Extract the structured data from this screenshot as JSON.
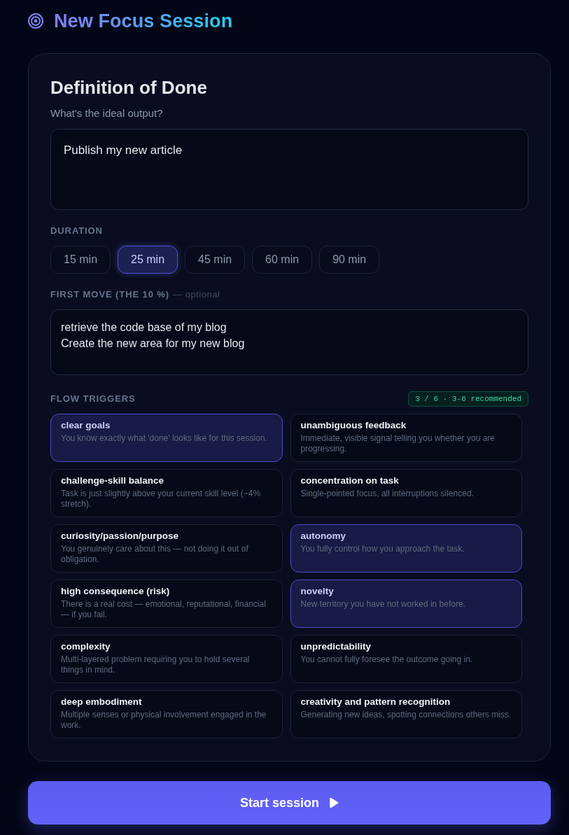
{
  "header": {
    "title": "New Focus Session"
  },
  "card": {
    "title": "Definition of Done",
    "output": {
      "label": "What's the ideal output?",
      "value": "Publish my new article"
    },
    "duration": {
      "label": "DURATION",
      "options": [
        {
          "label": "15 min",
          "selected": false
        },
        {
          "label": "25 min",
          "selected": true
        },
        {
          "label": "45 min",
          "selected": false
        },
        {
          "label": "60 min",
          "selected": false
        },
        {
          "label": "90 min",
          "selected": false
        }
      ]
    },
    "first_move": {
      "label": "FIRST MOVE (THE 10 %)",
      "hint": "— optional",
      "value": "retrieve the code base of my blog\nCreate the new area for my new blog"
    },
    "flow_triggers": {
      "label": "FLOW TRIGGERS",
      "badge": "3 / 6 · 3-6 recommended",
      "items": [
        {
          "title": "clear goals",
          "description": "You know exactly what 'done' looks like for this session.",
          "selected": true
        },
        {
          "title": "unambiguous feedback",
          "description": "Immediate, visible signal telling you whether you are progressing.",
          "selected": false
        },
        {
          "title": "challenge-skill balance",
          "description": "Task is just slightly above your current skill level (~4% stretch).",
          "selected": false
        },
        {
          "title": "concentration on task",
          "description": "Single-pointed focus, all interruptions silenced.",
          "selected": false
        },
        {
          "title": "curiosity/passion/purpose",
          "description": "You genuinely care about this — not doing it out of obligation.",
          "selected": false
        },
        {
          "title": "autonomy",
          "description": "You fully control how you approach the task.",
          "selected": true
        },
        {
          "title": "high consequence (risk)",
          "description": "There is a real cost — emotional, reputational, financial — if you fail.",
          "selected": false
        },
        {
          "title": "novelty",
          "description": "New territory you have not worked in before.",
          "selected": true
        },
        {
          "title": "complexity",
          "description": "Multi-layered problem requiring you to hold several things in mind.",
          "selected": false
        },
        {
          "title": "unpredictability",
          "description": "You cannot fully foresee the outcome going in.",
          "selected": false
        },
        {
          "title": "deep embodiment",
          "description": "Multiple senses or physical involvement engaged in the work.",
          "selected": false
        },
        {
          "title": "creativity and pattern recognition",
          "description": "Generating new ideas, spotting connections others miss.",
          "selected": false
        }
      ]
    }
  },
  "start_button": {
    "label": "Start session"
  }
}
